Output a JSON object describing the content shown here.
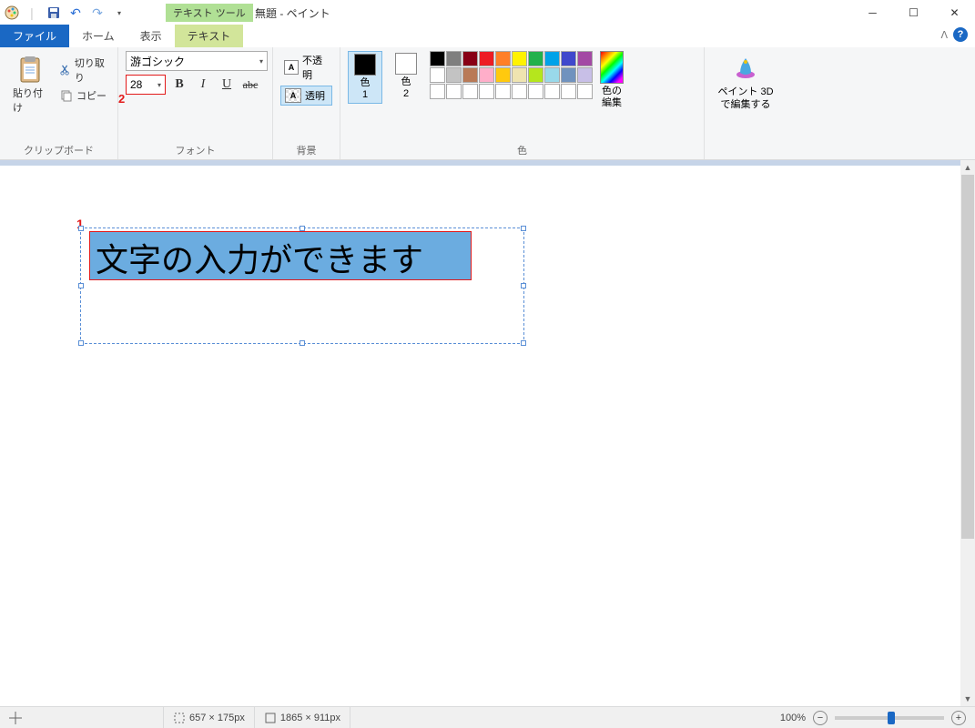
{
  "title": {
    "contextual_tab": "テキスト ツール",
    "document": "無題 - ペイント"
  },
  "tabs": {
    "file": "ファイル",
    "home": "ホーム",
    "view": "表示",
    "text": "テキスト"
  },
  "ribbon": {
    "clipboard": {
      "paste": "貼り付け",
      "cut": "切り取り",
      "copy": "コピー",
      "label": "クリップボード"
    },
    "font": {
      "family": "游ゴシック",
      "size": "28",
      "bold": "B",
      "italic": "I",
      "underline": "U",
      "strike": "abc",
      "label": "フォント"
    },
    "background": {
      "opaque": "不透明",
      "transparent": "透明",
      "label": "背景"
    },
    "color": {
      "color1_label": "色\n1",
      "color2_label": "色\n2",
      "edit_label": "色の\n編集",
      "label": "色",
      "color1_hex": "#000000",
      "color2_hex": "#ffffff",
      "palette_row1": [
        "#000000",
        "#7f7f7f",
        "#880015",
        "#ed1c24",
        "#ff7f27",
        "#fff200",
        "#22b14c",
        "#00a2e8",
        "#3f48cc",
        "#a349a4"
      ],
      "palette_row2": [
        "#ffffff",
        "#c3c3c3",
        "#b97a57",
        "#ffaec9",
        "#ffc90e",
        "#efe4b0",
        "#b5e61d",
        "#99d9ea",
        "#7092be",
        "#c8bfe7"
      ],
      "palette_row3": [
        "#ffffff",
        "#ffffff",
        "#ffffff",
        "#ffffff",
        "#ffffff",
        "#ffffff",
        "#ffffff",
        "#ffffff",
        "#ffffff",
        "#ffffff"
      ]
    },
    "paint3d": {
      "label": "ペイント 3D\nで編集する"
    }
  },
  "canvas": {
    "text_value": "文字の入力ができます"
  },
  "annotations": {
    "a1": "1",
    "a2": "2"
  },
  "status": {
    "selection": "657 × 175px",
    "canvas_size": "1865 × 911px",
    "zoom": "100%"
  }
}
